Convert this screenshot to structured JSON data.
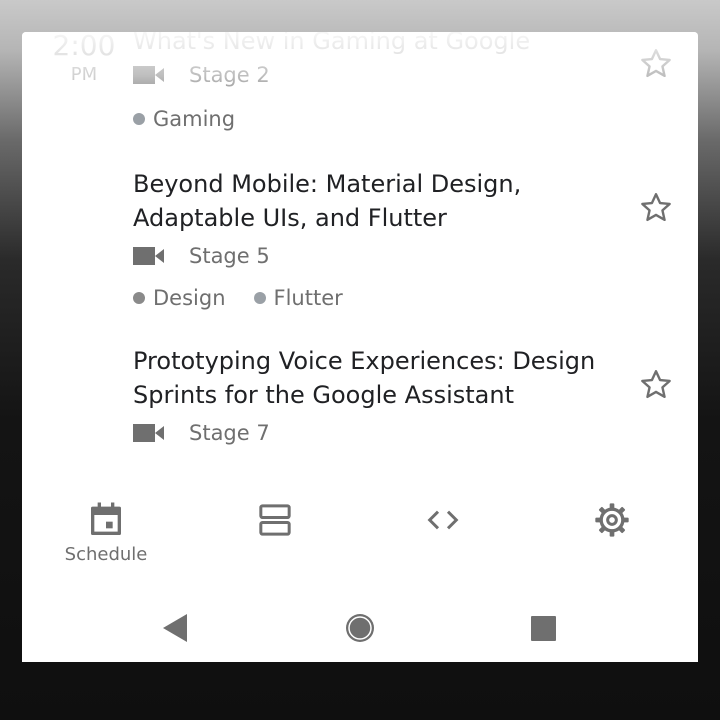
{
  "schedule": {
    "time": {
      "hour": "2:00",
      "ampm": "PM"
    },
    "sessions": [
      {
        "title": "What's New in Gaming at Google",
        "room": "Stage 2",
        "tags": [
          {
            "name": "Gaming",
            "color": "#9aa0a6"
          }
        ],
        "starred": false
      },
      {
        "title": "Beyond Mobile: Material Design, Adaptable UIs, and Flutter",
        "room": "Stage 5",
        "tags": [
          {
            "name": "Design",
            "color": "#8a8a8a"
          },
          {
            "name": "Flutter",
            "color": "#9aa0a6"
          }
        ],
        "starred": false
      },
      {
        "title": "Prototyping Voice Experiences: Design Sprints for the Google Assistant",
        "room": "Stage 7",
        "tags": [],
        "starred": false
      }
    ]
  },
  "bottom_nav": {
    "items": [
      {
        "label": "Schedule",
        "icon": "calendar-icon",
        "selected": true
      },
      {
        "label": "",
        "icon": "view-agenda-icon",
        "selected": false
      },
      {
        "label": "",
        "icon": "code-icon",
        "selected": false
      },
      {
        "label": "",
        "icon": "gear-icon",
        "selected": false
      }
    ]
  },
  "system_nav": {
    "icons": [
      "back-icon",
      "home-icon",
      "recents-icon"
    ]
  },
  "colors": {
    "icon": "#6f6f6f",
    "text_primary": "#202124",
    "text_secondary": "#6f6f6f"
  }
}
